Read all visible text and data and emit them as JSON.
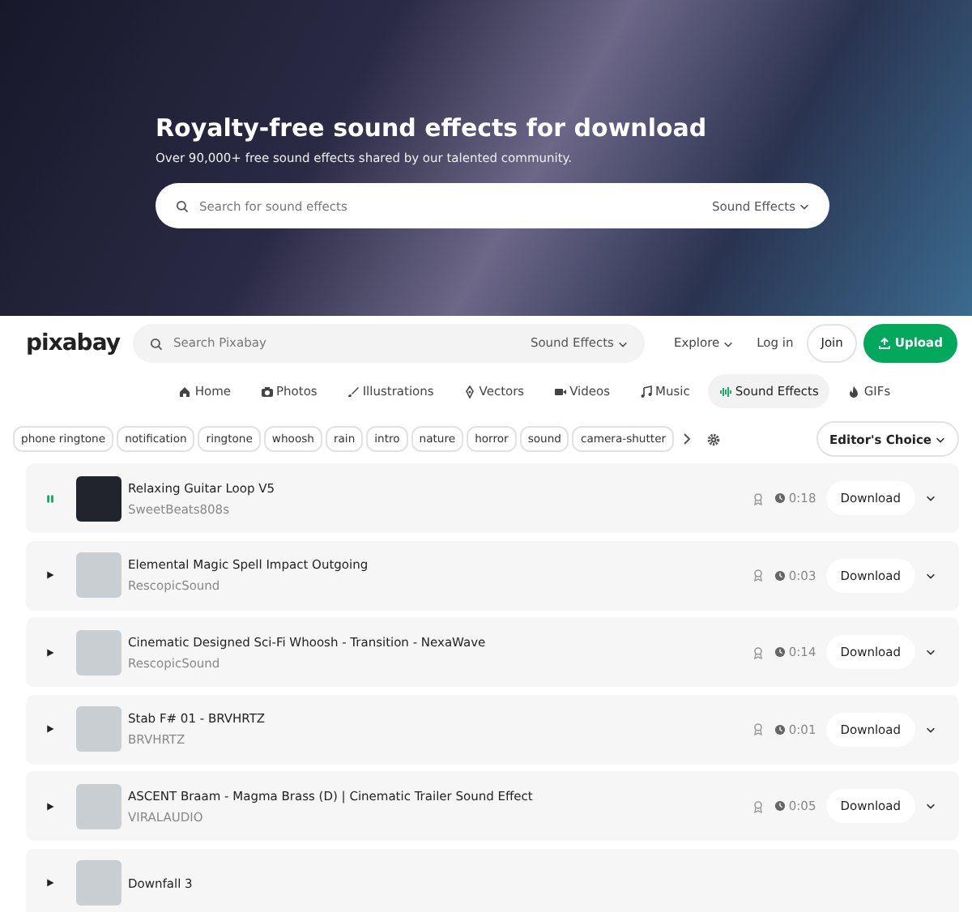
{
  "hero": {
    "title": "Royalty-free sound effects for download",
    "subtitle": "Over 90,000+ free sound effects shared by our talented community.",
    "search": {
      "placeholder": "Search for sound effects",
      "category": "Sound Effects"
    }
  },
  "header": {
    "logo": "pixabay",
    "search": {
      "placeholder": "Search Pixabay",
      "category": "Sound Effects"
    },
    "explore": "Explore",
    "login": "Log in",
    "join": "Join",
    "upload": "Upload"
  },
  "categories": [
    {
      "label": "Home",
      "kind": "home",
      "selected": false
    },
    {
      "label": "Photos",
      "kind": "photos",
      "selected": false
    },
    {
      "label": "Illustrations",
      "kind": "illustrations",
      "selected": false
    },
    {
      "label": "Vectors",
      "kind": "vectors",
      "selected": false
    },
    {
      "label": "Videos",
      "kind": "videos",
      "selected": false
    },
    {
      "label": "Music",
      "kind": "music",
      "selected": false
    },
    {
      "label": "Sound Effects",
      "kind": "sounds",
      "selected": true
    },
    {
      "label": "GIFs",
      "kind": "gifs",
      "selected": false
    }
  ],
  "tags": [
    "phone ringtone",
    "notification",
    "ringtone",
    "whoosh",
    "rain",
    "intro",
    "nature",
    "horror",
    "sound",
    "camera-shutter"
  ],
  "sort": "Editor's Choice",
  "tracks": [
    {
      "title": "Relaxing Guitar Loop V5",
      "author": "SweetBeats808s",
      "duration": "0:18",
      "download": "Download",
      "playing": true
    },
    {
      "title": "Elemental Magic Spell Impact Outgoing",
      "author": "RescopicSound",
      "duration": "0:03",
      "download": "Download",
      "playing": false
    },
    {
      "title": "Cinematic Designed Sci-Fi Whoosh - Transition - NexaWave",
      "author": "RescopicSound",
      "duration": "0:14",
      "download": "Download",
      "playing": false
    },
    {
      "title": "Stab F# 01 - BRVHRTZ",
      "author": "BRVHRTZ",
      "duration": "0:01",
      "download": "Download",
      "playing": false
    },
    {
      "title": "ASCENT Braam - Magma Brass (D) | Cinematic Trailer Sound Effect",
      "author": "VIRALAUDIO",
      "duration": "0:05",
      "download": "Download",
      "playing": false
    },
    {
      "title": "Downfall 3",
      "playing": false
    }
  ]
}
